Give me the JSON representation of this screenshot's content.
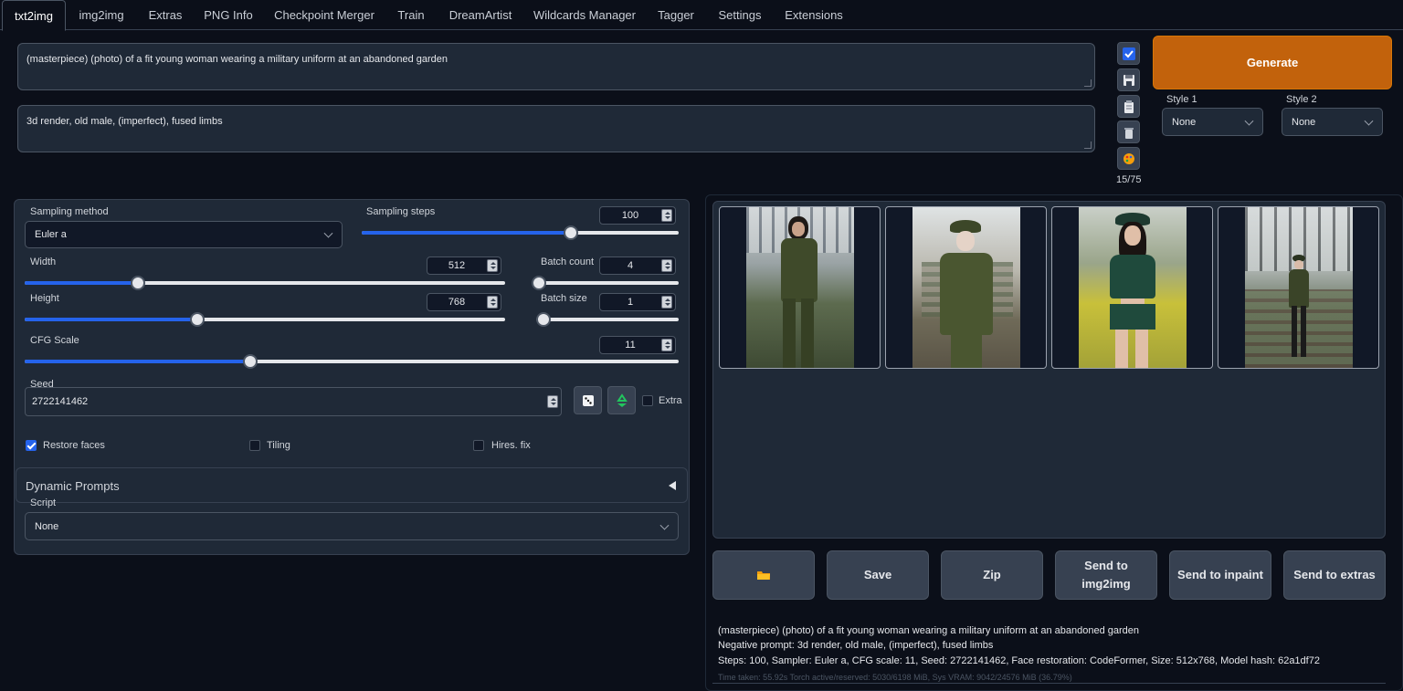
{
  "tabs": [
    "txt2img",
    "img2img",
    "Extras",
    "PNG Info",
    "Checkpoint Merger",
    "Train",
    "DreamArtist",
    "Wildcards Manager",
    "Tagger",
    "Settings",
    "Extensions"
  ],
  "prompt": "(masterpiece) (photo) of a fit young woman wearing a military uniform at an abandoned garden",
  "negative_prompt": "3d render, old male, (imperfect), fused limbs",
  "token_counter": "15/75",
  "generate_label": "Generate",
  "style1": {
    "label": "Style 1",
    "value": "None"
  },
  "style2": {
    "label": "Style 2",
    "value": "None"
  },
  "sampling_method": {
    "label": "Sampling method",
    "value": "Euler a"
  },
  "sampling_steps": {
    "label": "Sampling steps",
    "value": "100",
    "fraction": 0.66
  },
  "width": {
    "label": "Width",
    "value": "512",
    "fraction": 0.235
  },
  "height": {
    "label": "Height",
    "value": "768",
    "fraction": 0.36
  },
  "batch_count": {
    "label": "Batch count",
    "value": "4",
    "fraction": 0.02
  },
  "batch_size": {
    "label": "Batch size",
    "value": "1",
    "fraction": 0.0
  },
  "cfg_scale": {
    "label": "CFG Scale",
    "value": "11",
    "fraction": 0.345
  },
  "seed": {
    "label": "Seed",
    "value": "2722141462",
    "extra_label": "Extra"
  },
  "checkboxes": {
    "restore_faces": "Restore faces",
    "tiling": "Tiling",
    "hires_fix": "Hires. fix"
  },
  "dynamic_prompts": "Dynamic Prompts",
  "script": {
    "label": "Script",
    "value": "None"
  },
  "actions": {
    "save": "Save",
    "zip": "Zip",
    "send_img2img": "Send to img2img",
    "send_inpaint": "Send to inpaint",
    "send_extras": "Send to extras"
  },
  "info": {
    "line1": "(masterpiece) (photo) of a fit young woman wearing a military uniform at an abandoned garden",
    "line2": "Negative prompt: 3d render, old male, (imperfect), fused limbs",
    "line3": "Steps: 100, Sampler: Euler a, CFG scale: 11, Seed: 2722141462, Face restoration: CodeFormer, Size: 512x768, Model hash: 62a1df72",
    "timing": "Time taken: 55.92s  Torch active/reserved: 5030/6198 MiB, Sys VRAM: 9042/24576 MiB (36.79%)"
  },
  "colors": {
    "accent": "#2563eb",
    "generate": "#c2620c",
    "background": "#0b0f19",
    "panel": "#1f2937"
  }
}
